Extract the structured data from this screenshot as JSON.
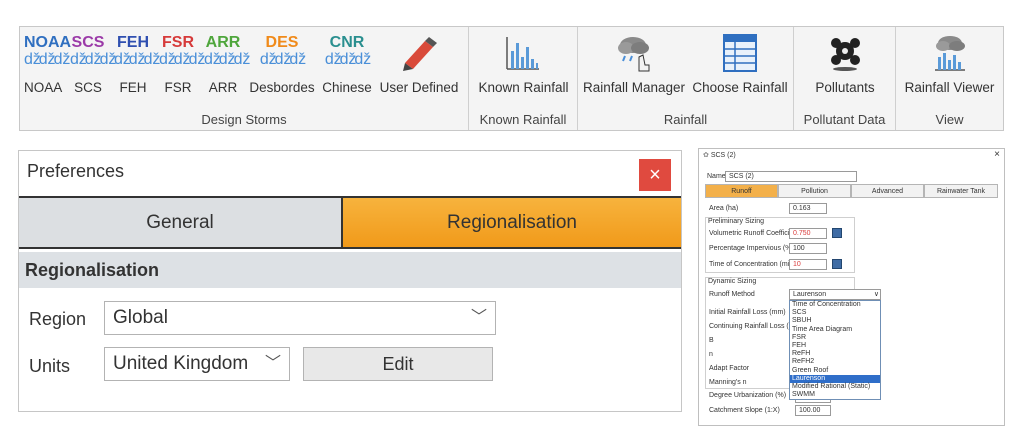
{
  "ribbon": {
    "groups": [
      {
        "label": "Design Storms",
        "buttons": [
          {
            "code": "NOAA",
            "label": "NOAA",
            "color": "#2f6fc0"
          },
          {
            "code": "SCS",
            "label": "SCS",
            "color": "#9b3aa8"
          },
          {
            "code": "FEH",
            "label": "FEH",
            "color": "#2f4fb0"
          },
          {
            "code": "FSR",
            "label": "FSR",
            "color": "#d63a3a"
          },
          {
            "code": "ARR",
            "label": "ARR",
            "color": "#4fa63c"
          },
          {
            "code": "DES",
            "label": "Desbordes",
            "color": "#f08a1a"
          },
          {
            "code": "CNR",
            "label": "Chinese",
            "color": "#2a8f8f"
          },
          {
            "code": "",
            "label": "User Defined",
            "icon": "pencil-icon"
          }
        ]
      },
      {
        "label": "Known Rainfall",
        "buttons": [
          {
            "label": "Known Rainfall",
            "icon": "bar-chart-icon"
          }
        ]
      },
      {
        "label": "Rainfall",
        "buttons": [
          {
            "label": "Rainfall Manager",
            "icon": "cloud-hand-icon"
          },
          {
            "label": "Choose Rainfall",
            "icon": "table-icon"
          }
        ]
      },
      {
        "label": "Pollutant Data",
        "buttons": [
          {
            "label": "Pollutants",
            "icon": "pollutant-icon"
          }
        ]
      },
      {
        "label": "View",
        "buttons": [
          {
            "label": "Rainfall Viewer",
            "icon": "rain-chart-icon"
          }
        ]
      }
    ]
  },
  "preferences": {
    "title": "Preferences",
    "close": "×",
    "tabs": [
      "General",
      "Regionalisation"
    ],
    "section": "Regionalisation",
    "region_label": "Region",
    "region_value": "Global",
    "units_label": "Units",
    "units_value": "United Kingdom",
    "edit_label": "Edit"
  },
  "scs": {
    "title": "SCS (2)",
    "close": "×",
    "name_label": "Name",
    "name_value": "SCS (2)",
    "tabs": [
      "Runoff",
      "Pollution",
      "Advanced",
      "Rainwater Tank"
    ],
    "area_label": "Area (ha)",
    "area_value": "0.163",
    "prelim_title": "Preliminary Sizing",
    "vrc_label": "Volumetric Runoff Coefficient",
    "vrc_value": "0.750",
    "imp_label": "Percentage Impervious (%)",
    "imp_value": "100",
    "toc_label": "Time of Concentration (mins)",
    "toc_value": "10",
    "dyn_title": "Dynamic Sizing",
    "method_label": "Runoff Method",
    "method_value": "Laurenson",
    "labels": [
      "Initial Rainfall Loss (mm)",
      "Continuing Rainfall Loss (mm/h",
      "B",
      "n",
      "Adapt Factor",
      "Manning's n",
      "Degree Urbanization (%)",
      "Catchment Slope (1:X)"
    ],
    "slope_value": "100.00",
    "options": [
      "Time of Concentration",
      "SCS",
      "SBUH",
      "Time Area Diagram",
      "FSR",
      "FEH",
      "ReFH",
      "ReFH2",
      "Green Roof",
      "Laurenson",
      "Modified Rational (Static)",
      "SWMM"
    ],
    "selected_index": 9
  }
}
